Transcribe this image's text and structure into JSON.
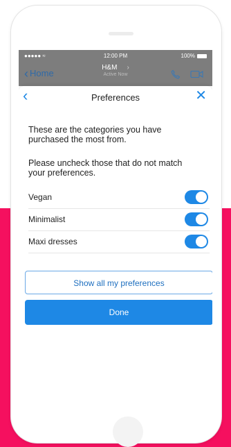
{
  "status_bar": {
    "signal": "●●●●● ≈",
    "time": "12:00 PM",
    "battery": "100%"
  },
  "chat_header": {
    "back_label": "Home",
    "title": "H&M",
    "subtitle": "Active Now",
    "icons": [
      "phone-icon",
      "video-icon"
    ]
  },
  "preferences": {
    "title": "Preferences",
    "intro_line1": "These are the categories you have purchased the most from.",
    "intro_line2": "Please uncheck those that do not match your preferences.",
    "items": [
      {
        "label": "Vegan",
        "checked": true
      },
      {
        "label": "Minimalist",
        "checked": true
      },
      {
        "label": "Maxi dresses",
        "checked": true
      }
    ],
    "show_all_label": "Show all my preferences",
    "done_label": "Done"
  },
  "colors": {
    "accent": "#1e88e5",
    "brand_background": "#f5105f"
  }
}
